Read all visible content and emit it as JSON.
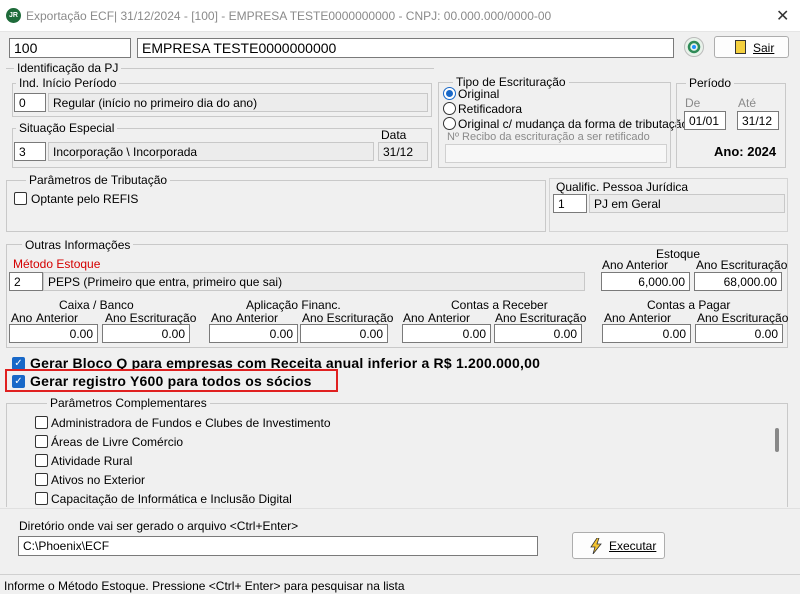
{
  "window": {
    "title": "Exportação ECF| 31/12/2024 - [100] - EMPRESA TESTE0000000000 - CNPJ: 00.000.000/0000-00",
    "app_icon_text": "JR",
    "close_glyph": "✕"
  },
  "top": {
    "company_code": "100",
    "company_name": "EMPRESA TESTE0000000000",
    "exit_label": "Sair"
  },
  "identificacao": {
    "group_label": "Identificação da PJ",
    "ind_inicio": {
      "label": "Ind. Início Período",
      "code": "0",
      "description": "Regular (início no primeiro dia do ano)"
    },
    "situacao": {
      "label": "Situação Especial",
      "code": "3",
      "description": "Incorporação \\ Incorporada",
      "date_label": "Data",
      "date": "31/12"
    }
  },
  "tipo_escrituracao": {
    "label": "Tipo de Escrituração",
    "options": [
      "Original",
      "Retificadora",
      "Original c/ mudança da forma de tributação"
    ],
    "selected": "Original",
    "recibo_label": "Nº Recibo da escrituração a ser retificado",
    "recibo_value": ""
  },
  "periodo": {
    "label": "Período",
    "de_label": "De",
    "ate_label": "Até",
    "de": "01/01",
    "ate": "31/12",
    "ano_text": "Ano: 2024"
  },
  "tributacao": {
    "label": "Parâmetros de Tributação",
    "refis_label": "Optante pelo REFIS",
    "refis_checked": false,
    "qualific_label": "Qualific. Pessoa Jurídica",
    "qualific_code": "1",
    "qualific_desc": "PJ em Geral"
  },
  "outras": {
    "label": "Outras Informações",
    "metodo_label": "Método Estoque",
    "metodo_code": "2",
    "metodo_desc": "PEPS (Primeiro que entra, primeiro que sai)",
    "estoque": {
      "label": "Estoque",
      "ano_anterior_label": "Ano Anterior",
      "ano_escrituracao_label": "Ano Escrituração",
      "ano_anterior": "6,000.00",
      "ano_escrituracao": "68,000.00"
    },
    "blocks": [
      {
        "title": "Caixa / Banco",
        "ano_label": "Ano",
        "anterior_label": "Anterior",
        "escrit_label": "Ano Escrituração",
        "anterior": "0.00",
        "escrit": "0.00"
      },
      {
        "title": "Aplicação Financ.",
        "ano_label": "Ano",
        "anterior_label": "Anterior",
        "escrit_label": "Ano Escrituração",
        "anterior": "0.00",
        "escrit": "0.00"
      },
      {
        "title": "Contas a Receber",
        "ano_label": "Ano",
        "anterior_label": "Anterior",
        "escrit_label": "Ano Escrituração",
        "anterior": "0.00",
        "escrit": "0.00"
      },
      {
        "title": "Contas a Pagar",
        "ano_label": "Ano",
        "anterior_label": "Anterior",
        "escrit_label": "Ano Escrituração",
        "anterior": "0.00",
        "escrit": "0.00"
      }
    ]
  },
  "checks": {
    "bloco_q": "Gerar Bloco Q para empresas com Receita anual inferior a R$ 1.200.000,00",
    "y600": "Gerar registro Y600 para todos os sócios",
    "highlight_color": "#e02020"
  },
  "complementares": {
    "label": "Parâmetros Complementares",
    "items": [
      "Administradora de Fundos e Clubes de Investimento",
      "Áreas de Livre Comércio",
      "Atividade Rural",
      "Ativos no Exterior",
      "Capacitação de Informática e Inclusão Digital"
    ]
  },
  "diretorio": {
    "label": "Diretório onde vai ser gerado o arquivo <Ctrl+Enter>",
    "value": "C:\\Phoenix\\ECF",
    "executar_label": "Executar"
  },
  "status": "Informe o Método Estoque. Pressione <Ctrl+ Enter> para pesquisar na lista",
  "icons": {
    "refresh": "refresh-icon",
    "door": "exit-door-icon",
    "lightning": "lightning-icon"
  }
}
